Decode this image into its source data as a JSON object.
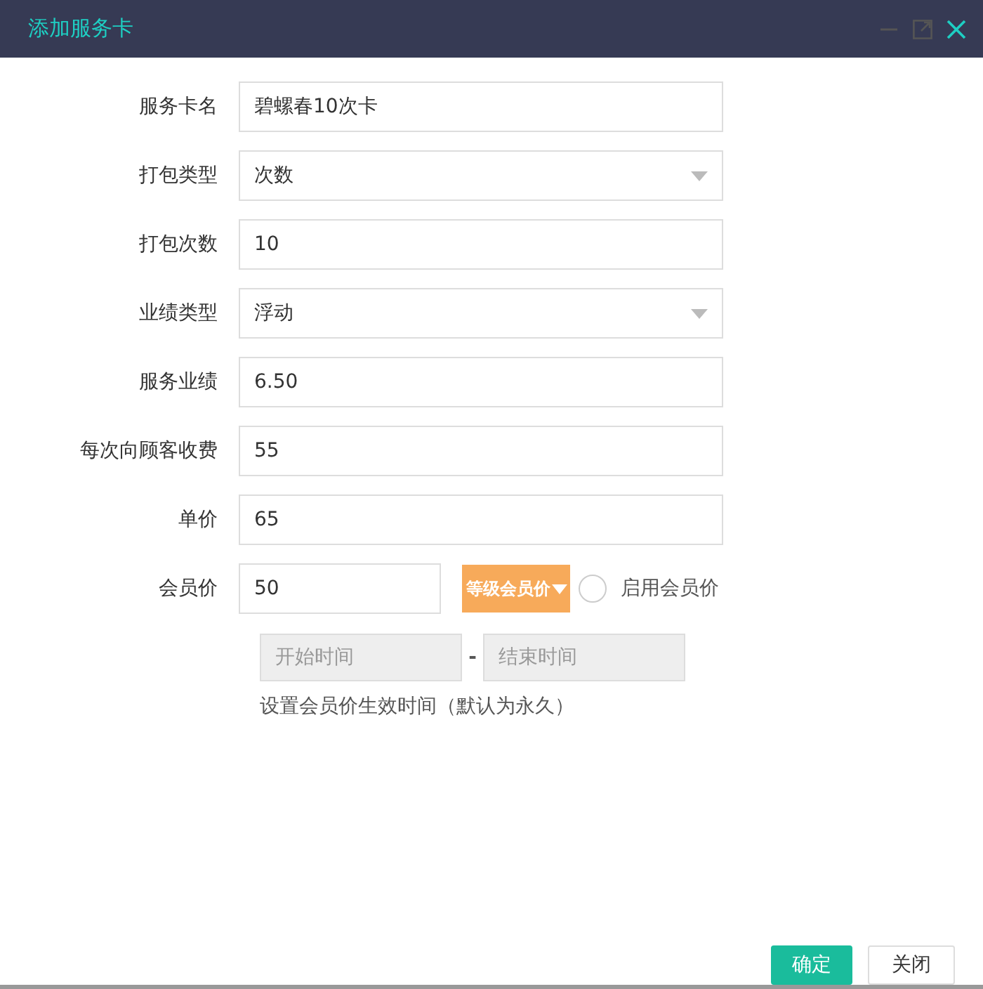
{
  "window": {
    "title": "添加服务卡"
  },
  "fields": [
    {
      "label": "服务卡名",
      "kind": "text",
      "value": "碧螺春10次卡"
    },
    {
      "label": "打包类型",
      "kind": "select",
      "value": "次数"
    },
    {
      "label": "打包次数",
      "kind": "text",
      "value": "10"
    },
    {
      "label": "业绩类型",
      "kind": "select",
      "value": "浮动"
    },
    {
      "label": "服务业绩",
      "kind": "text",
      "value": "6.50"
    },
    {
      "label": "每次向顾客收费",
      "kind": "text",
      "value": "55"
    },
    {
      "label": "单价",
      "kind": "text",
      "value": "65"
    }
  ],
  "member_price": {
    "label": "会员价",
    "value": "50",
    "level_button": "等级会员价",
    "enable": {
      "label": "启用会员价",
      "checked": false
    }
  },
  "period": {
    "start_placeholder": "开始时间",
    "separator": "-",
    "end_placeholder": "结束时间",
    "hint": "设置会员价生效时间（默认为永久）"
  },
  "buttons": [
    {
      "label": "确定",
      "kind": "primary"
    },
    {
      "label": "关闭",
      "kind": "secondary"
    }
  ]
}
